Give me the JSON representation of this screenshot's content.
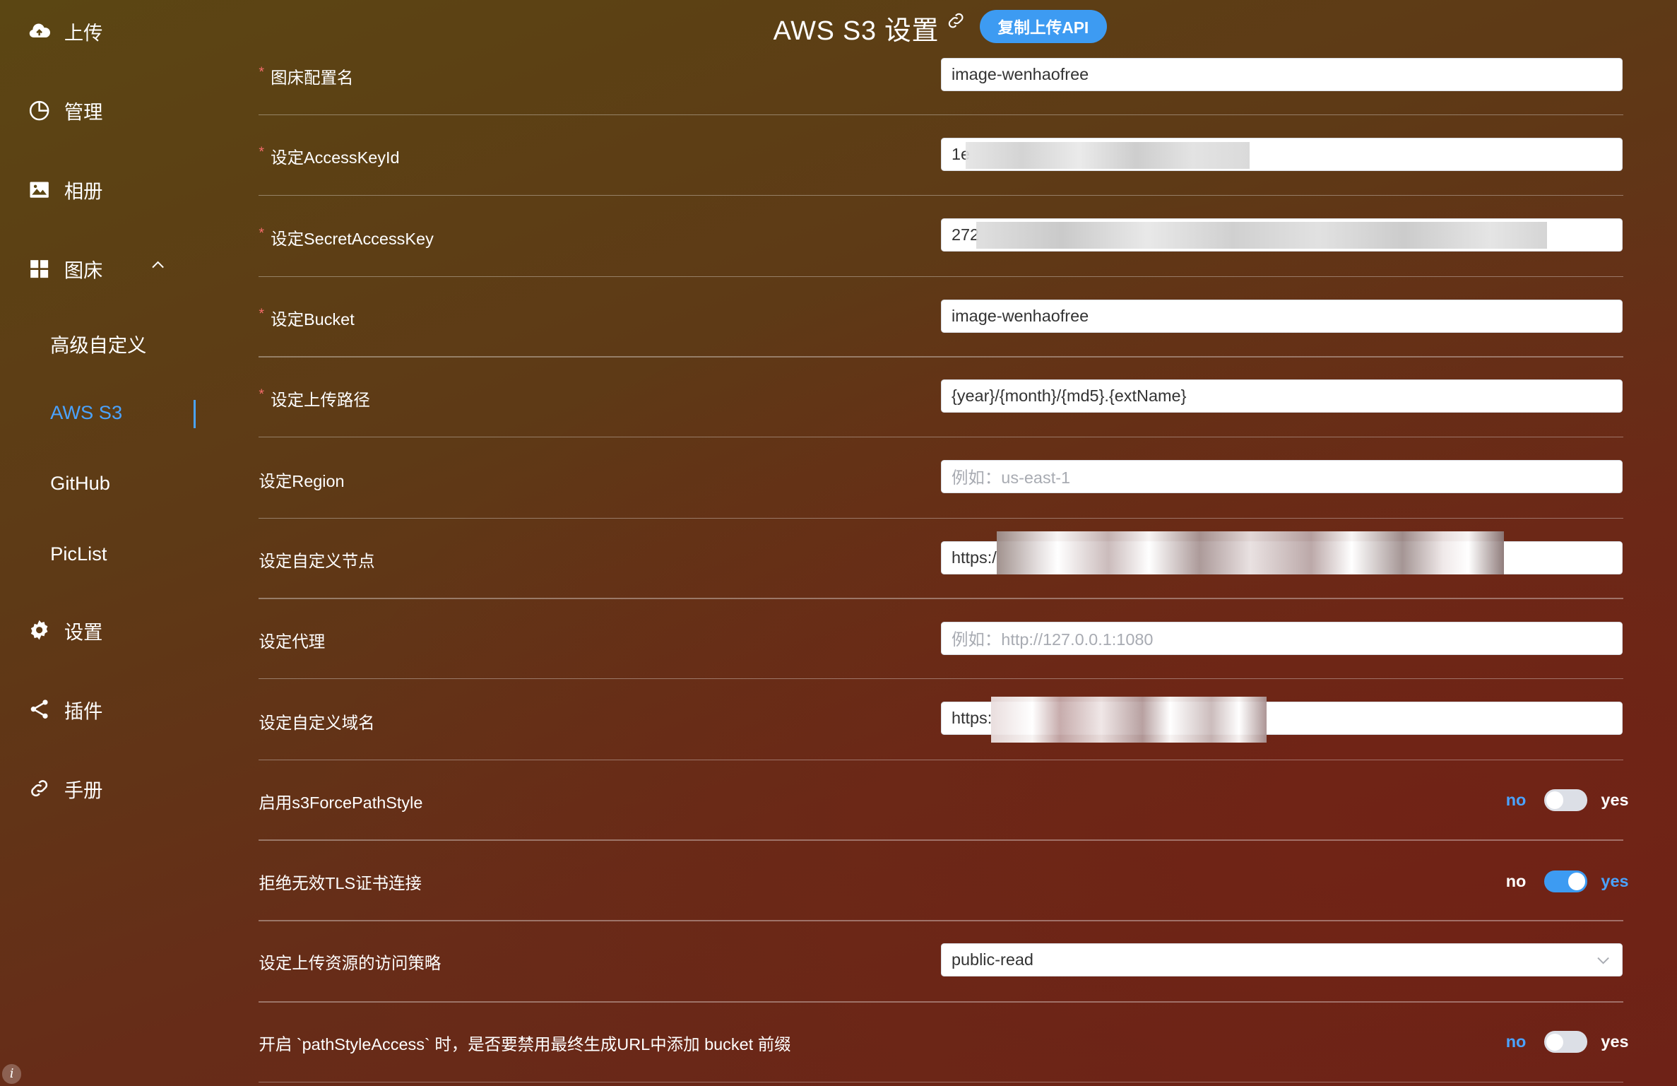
{
  "sidebar": {
    "upload": "上传",
    "manage": "管理",
    "gallery": "相册",
    "picbed": "图床",
    "sub": [
      "高级自定义",
      "AWS S3",
      "GitHub",
      "PicList"
    ],
    "settings": "设置",
    "plugins": "插件",
    "manual": "手册"
  },
  "header": {
    "title": "AWS S3 设置",
    "copy_api": "复制上传API"
  },
  "form": {
    "config_name": {
      "label": "图床配置名",
      "value": "image-wenhaofree",
      "required": true
    },
    "access_key": {
      "label": "设定AccessKeyId",
      "value": "1e",
      "required": true
    },
    "secret_key": {
      "label": "设定SecretAccessKey",
      "value": "272",
      "required": true
    },
    "bucket": {
      "label": "设定Bucket",
      "value": "image-wenhaofree",
      "required": true
    },
    "path": {
      "label": "设定上传路径",
      "value": "{year}/{month}/{md5}.{extName}",
      "required": true
    },
    "region": {
      "label": "设定Region",
      "placeholder": "例如：us-east-1"
    },
    "endpoint": {
      "label": "设定自定义节点",
      "value": "https:/"
    },
    "proxy": {
      "label": "设定代理",
      "placeholder": "例如：http://127.0.0.1:1080"
    },
    "domain": {
      "label": "设定自定义域名",
      "value": "https:"
    },
    "force_path_style": {
      "label": "启用s3ForcePathStyle",
      "no": "no",
      "yes": "yes",
      "state": "no"
    },
    "reject_tls": {
      "label": "拒绝无效TLS证书连接",
      "no": "no",
      "yes": "yes",
      "state": "yes"
    },
    "acl": {
      "label": "设定上传资源的访问策略",
      "value": "public-read"
    },
    "disable_bucket_prefix": {
      "label": "开启 `pathStyleAccess` 时，是否要禁用最终生成URL中添加 bucket 前缀",
      "no": "no",
      "yes": "yes",
      "state": "no"
    }
  },
  "colors": {
    "accent": "#3d9bf2",
    "required": "#f56c6c",
    "active_nav": "#4aa3ff"
  }
}
